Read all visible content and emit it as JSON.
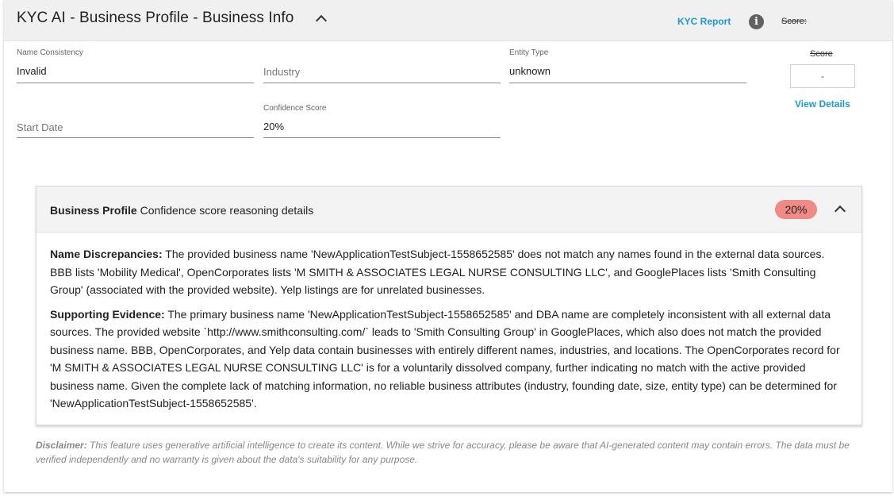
{
  "header": {
    "title": "KYC AI - Business Profile - Business Info",
    "kyc_report_label": "KYC Report",
    "info_icon_glyph": "i",
    "score_label": "Score:"
  },
  "fields": {
    "name_consistency": {
      "label": "Name Consistency",
      "value": "Invalid"
    },
    "industry": {
      "placeholder": "Industry"
    },
    "entity_type": {
      "label": "Entity Type",
      "value": "unknown"
    },
    "start_date": {
      "placeholder": "Start Date"
    },
    "confidence_score": {
      "label": "Confidence Score",
      "value": "20%"
    }
  },
  "score_panel": {
    "title": "Score",
    "value": "-",
    "view_details_label": "View Details"
  },
  "reasoning_panel": {
    "title_bold": "Business Profile",
    "title_rest": " Confidence score reasoning details",
    "badge": "20%",
    "sections": [
      {
        "heading": "Name Discrepancies:",
        "text": " The provided business name 'NewApplicationTestSubject-1558652585' does not match any names found in the external data sources. BBB lists 'Mobility Medical', OpenCorporates lists 'M SMITH & ASSOCIATES LEGAL NURSE CONSULTING LLC', and GooglePlaces lists 'Smith Consulting Group' (associated with the provided website). Yelp listings are for unrelated businesses."
      },
      {
        "heading": "Supporting Evidence:",
        "text": " The primary business name 'NewApplicationTestSubject-1558652585' and DBA name are completely inconsistent with all external data sources. The provided website `http://www.smithconsulting.com/` leads to 'Smith Consulting Group' in GooglePlaces, which also does not match the provided business name. BBB, OpenCorporates, and Yelp data contain businesses with entirely different names, industries, and locations. The OpenCorporates record for 'M SMITH & ASSOCIATES LEGAL NURSE CONSULTING LLC' is for a voluntarily dissolved company, further indicating no match with the active provided business name. Given the complete lack of matching information, no reliable business attributes (industry, founding date, size, entity type) can be determined for 'NewApplicationTestSubject-1558652585'."
      }
    ]
  },
  "disclaimer": {
    "label": "Disclaimer:",
    "text": " This feature uses generative artificial intelligence to create its content. While we strive for accuracy, please be aware that AI-generated content may contain errors. The data must be verified independently and no warranty is given about the data's suitability for any purpose."
  },
  "colors": {
    "accent_link": "#1a9ad6",
    "badge_red": "#f08a84",
    "header_bg": "#f0f0f0"
  }
}
